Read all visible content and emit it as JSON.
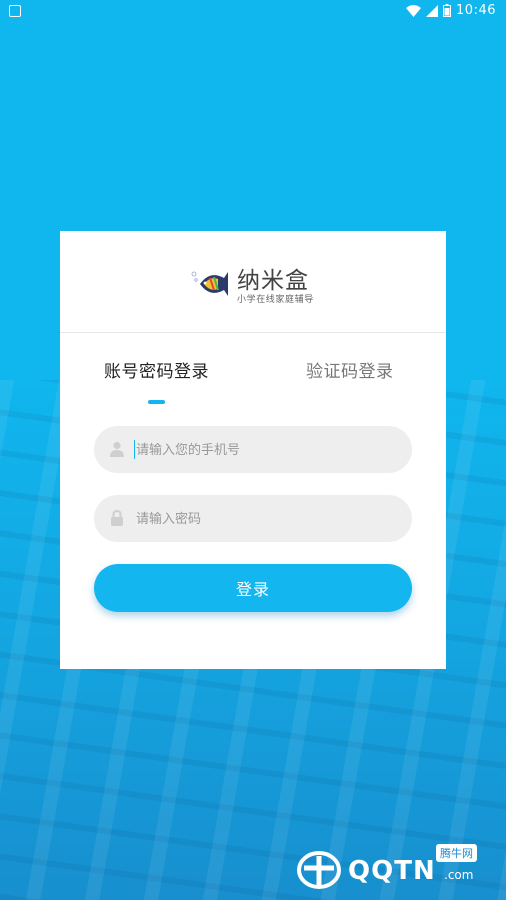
{
  "status_bar": {
    "time": "10:46"
  },
  "brand": {
    "name": "纳米盒",
    "tagline": "小学在线家庭辅导"
  },
  "tabs": [
    {
      "label": "账号密码登录",
      "active": true
    },
    {
      "label": "验证码登录",
      "active": false
    }
  ],
  "form": {
    "phone_placeholder": "请输入您的手机号",
    "password_placeholder": "请输入密码",
    "login_label": "登录"
  },
  "watermark": {
    "text": "QQTN",
    "suffix": ".com",
    "badge": "腾牛网"
  },
  "colors": {
    "accent": "#13b5ef",
    "background": "#10b6ee"
  }
}
